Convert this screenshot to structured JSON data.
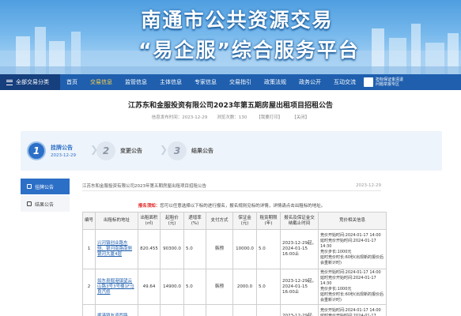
{
  "banner": {
    "title": "南通市公共资源交易",
    "subtitle": "“易企服”综合服务平台"
  },
  "nav": {
    "all_label": "全部交易分类",
    "items": [
      {
        "label": "首页",
        "active": false
      },
      {
        "label": "交易信息",
        "active": true
      },
      {
        "label": "监管信息",
        "active": false
      },
      {
        "label": "主体信息",
        "active": false
      },
      {
        "label": "专家信息",
        "active": false
      },
      {
        "label": "交易指引",
        "active": false
      },
      {
        "label": "政策法规",
        "active": false
      },
      {
        "label": "政务公开",
        "active": false
      },
      {
        "label": "互动交流",
        "active": false
      }
    ],
    "right_text": "担标保证金清退\n问题举报专区"
  },
  "article": {
    "title": "江苏东和金服投资有限公司2023年第五期房屋出租项目招租公告",
    "publish_time": "信息发布时间：2023-12-29",
    "views": "浏览次数：130",
    "print": "【我要打印】",
    "close": "【关闭】"
  },
  "steps": [
    {
      "num": "1",
      "label": "挂牌公告",
      "date": "2023-12-29",
      "active": true
    },
    {
      "num": "2",
      "label": "变更公告",
      "date": "",
      "active": false
    },
    {
      "num": "3",
      "label": "结果公告",
      "date": "",
      "active": false
    }
  ],
  "side_tabs": [
    {
      "label": "挂牌公告",
      "active": true
    },
    {
      "label": "结果公告",
      "active": false
    }
  ],
  "doc": {
    "name": "江苏东和金服投资有限公司2023年第五期房屋出租项目招租公告",
    "date": "2023-12-29",
    "notice_red": "报名须知：",
    "notice_text": "您可以任意选择以下标的进行报名，报名规则见标的详情，详情请点击出租标的地址。"
  },
  "table": {
    "headers": [
      "编号",
      "出租标的地址",
      "出租面积(㎡)",
      "起租价(元)",
      "递增率(%)",
      "支付方式",
      "保证金(元)",
      "租赁期限(年)",
      "报名及保证金交纳截止时间",
      "竞价相关信息"
    ],
    "rows": [
      {
        "no": "1",
        "address": "兴河镇创业路东侧、银河南路南侧银河大厦4层",
        "area": "820.455",
        "price": "90300.0",
        "rate": "5.0",
        "pay": "韩预",
        "deposit": "10000.0",
        "term": "5.0",
        "deadline": "2023-12-29起，2024-01-15 16:00止",
        "info": "竞价开始时间:2024-01-17 14:00\n延时竞价开始时间:2024-01-17 14:30\n竞价步长:1000元\n延时竞价时长:60秒(出现新的报价后会重新计时)"
      },
      {
        "no": "2",
        "address": "如东县掘港镇望云山路3号3号楼1F马良汽修",
        "area": "49.64",
        "price": "14900.0",
        "rate": "5.0",
        "pay": "韩预",
        "deposit": "2000.0",
        "term": "5.0",
        "deadline": "2023-12-29起，2024-01-15 16:00止",
        "info": "竞价开始时间:2024-01-17 14:00\n延时竞价开始时间:2024-01-17 14:30\n竞价步长:1000元\n延时竞价时长:60秒(出现新的报价后会重新计时)"
      },
      {
        "no": "",
        "address": "掘港镇友谊西路",
        "area": "",
        "price": "",
        "rate": "",
        "pay": "",
        "deposit": "",
        "term": "",
        "deadline": "2023-12-29起，",
        "info": "竞价开始时间:2024-01-17 14:00\n延时竞价开始时间:2024-01-17 14:30"
      }
    ]
  },
  "colors": {
    "nav_bg": "#1f5fae",
    "accent": "#2c6fc7",
    "active_nav": "#ffd54a",
    "notice_red": "#e02020"
  }
}
